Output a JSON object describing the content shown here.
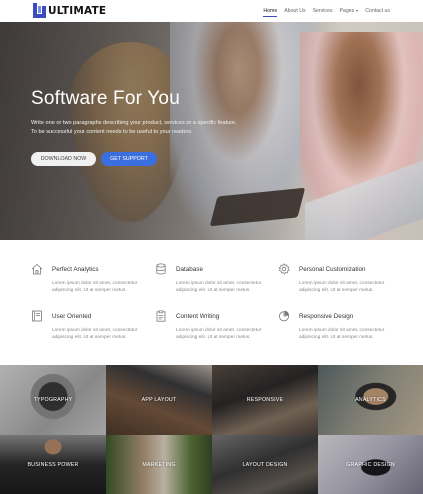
{
  "brand": {
    "name": "ULTIMATE",
    "accent": "#3b4cc0"
  },
  "nav": {
    "items": [
      {
        "label": "Home",
        "active": true
      },
      {
        "label": "About Us",
        "active": false
      },
      {
        "label": "Services",
        "active": false
      },
      {
        "label": "Pages",
        "active": false,
        "dropdown": true
      },
      {
        "label": "Contact us",
        "active": false
      }
    ]
  },
  "hero": {
    "title": "Software For You",
    "text": "Write one or two paragraphs describing your product, services or a specific feature. To be successful your content needs to be useful to your readers.",
    "btn_download": "Download Now",
    "btn_support": "Get Support",
    "btn_support_color": "#3b6fe0"
  },
  "features": [
    {
      "icon": "home-icon",
      "title": "Perfect Analytics",
      "desc": "Lorem ipsum dolor sit amet, consectetur adipiscing elit. Ut at semper metus."
    },
    {
      "icon": "database-icon",
      "title": "Database",
      "desc": "Lorem ipsum dolor sit amet, consectetur adipiscing elit. Ut at semper metus."
    },
    {
      "icon": "gear-icon",
      "title": "Personal Customization",
      "desc": "Lorem ipsum dolor sit amet, consectetur adipiscing elit. Ut at semper metus."
    },
    {
      "icon": "book-icon",
      "title": "User Oriented",
      "desc": "Lorem ipsum dolor sit amet, consectetur adipiscing elit. Ut at semper metus."
    },
    {
      "icon": "clipboard-icon",
      "title": "Content Writing",
      "desc": "Lorem ipsum dolor sit amet, consectetur adipiscing elit. Ut at semper metus."
    },
    {
      "icon": "pie-chart-icon",
      "title": "Responsive Design",
      "desc": "Lorem ipsum dolor sit amet, consectetur adipiscing elit. Ut at semper metus."
    }
  ],
  "gallery": [
    {
      "label": "Typography"
    },
    {
      "label": "App Layout"
    },
    {
      "label": "Responsive"
    },
    {
      "label": "Analytics"
    },
    {
      "label": "Business Power"
    },
    {
      "label": "Marketing"
    },
    {
      "label": "Layout Design"
    },
    {
      "label": "Graphic Design"
    }
  ]
}
